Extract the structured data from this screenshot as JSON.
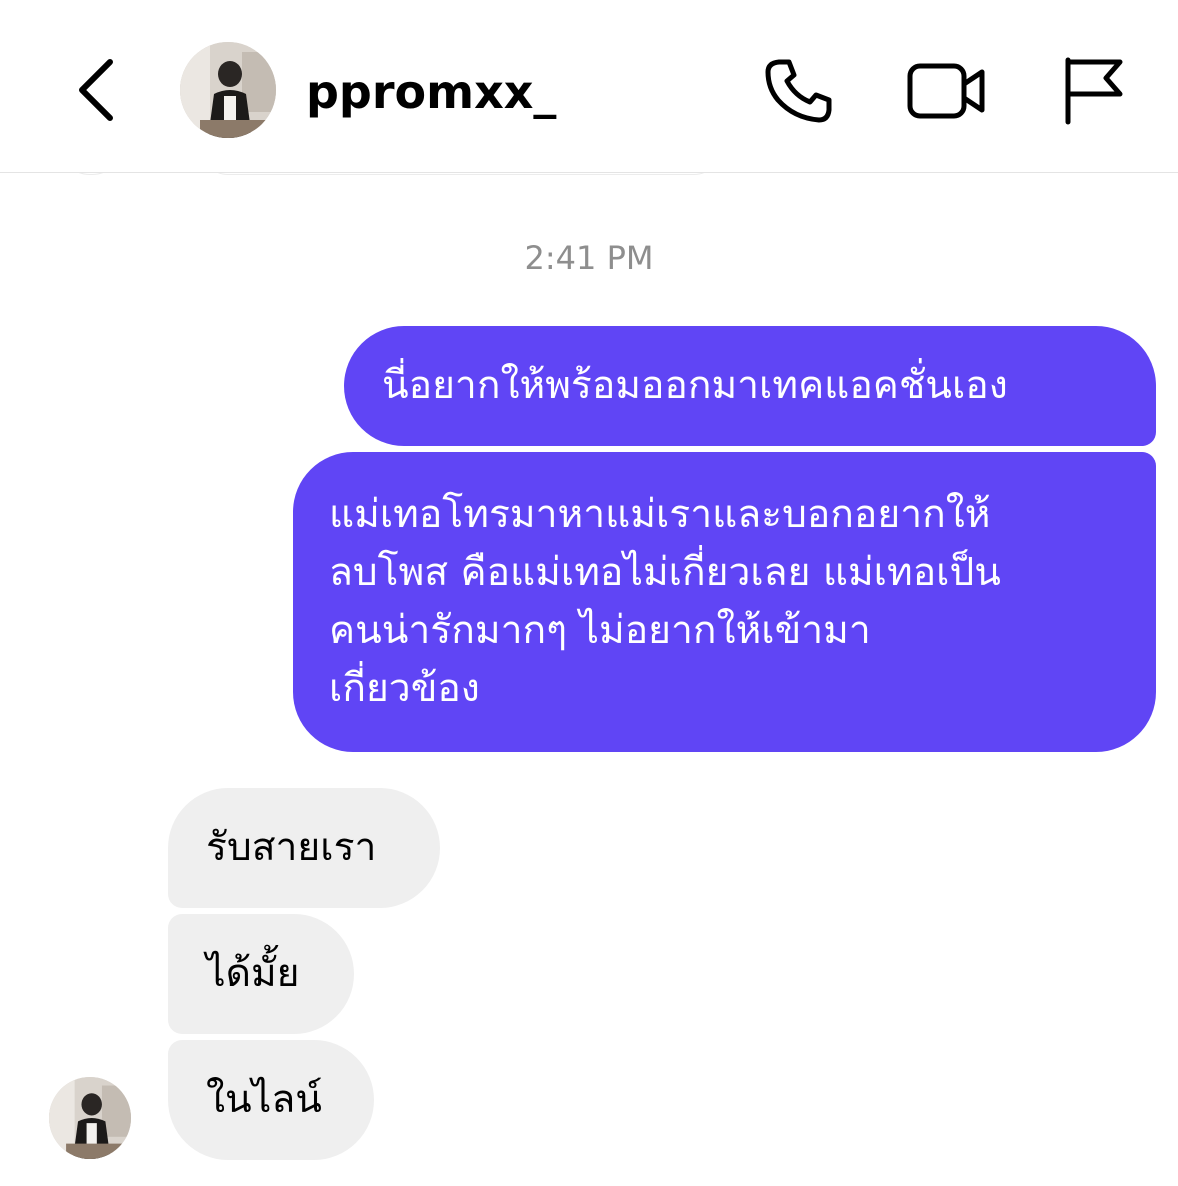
{
  "header": {
    "username": "ppromxx_",
    "avatar_icon": "profile-photo",
    "back_icon": "chevron-left-icon",
    "call_icon": "phone-icon",
    "video_icon": "video-camera-icon",
    "report_icon": "flag-icon"
  },
  "conversation": {
    "timestamp": "2:41 PM",
    "messages": [
      {
        "sender": "me",
        "text": "นี่อยากให้พร้อมออกมาเทคแอคชั่นเอง"
      },
      {
        "sender": "me",
        "text": "แม่เทอโทรมาหาแม่เราและบอกอยากให้\nลบโพส คือแม่เทอไม่เกี่ยวเลย แม่เทอเป็น\nคนน่ารักมากๆ ไม่อยากให้เข้ามา\nเกี่ยวข้อง"
      },
      {
        "sender": "ppromxx_",
        "text": "รับสายเรา"
      },
      {
        "sender": "ppromxx_",
        "text": "ได้มั้ย"
      },
      {
        "sender": "ppromxx_",
        "text": "ในไลน์"
      }
    ]
  },
  "colors": {
    "sent_bubble": "#6045f5",
    "received_bubble": "#efefef",
    "timestamp": "#8e8e8e"
  }
}
